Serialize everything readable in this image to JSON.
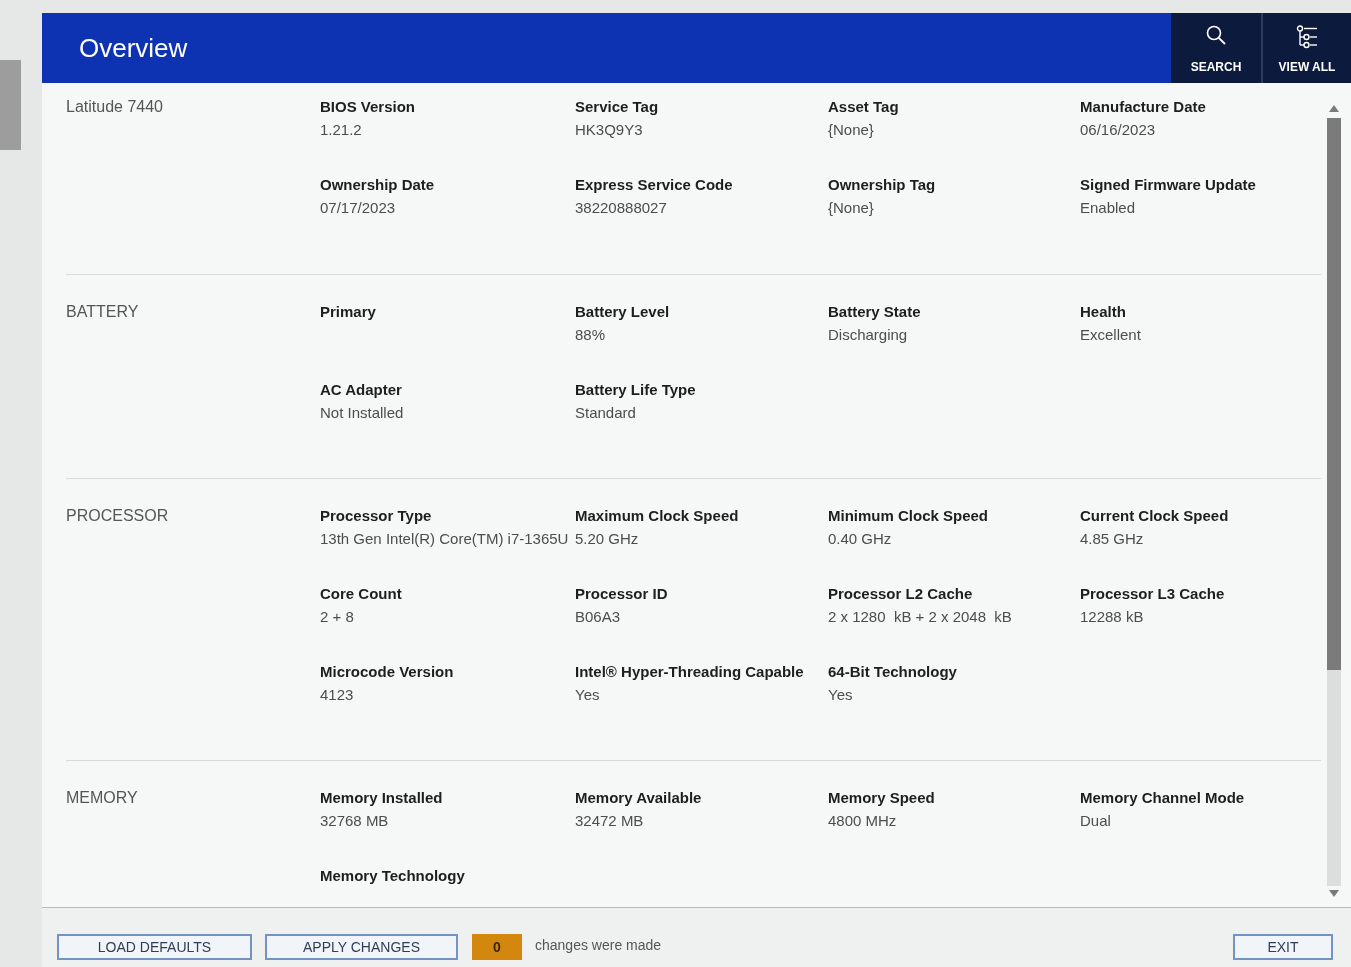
{
  "header": {
    "title": "Overview",
    "actions": [
      {
        "kind": "search",
        "label": "SEARCH"
      },
      {
        "kind": "view-all",
        "label": "VIEW ALL"
      }
    ]
  },
  "sections": [
    {
      "title": "Latitude 7440",
      "rows": [
        [
          {
            "label": "BIOS Version",
            "value": "1.21.2"
          },
          {
            "label": "Service Tag",
            "value": "HK3Q9Y3"
          },
          {
            "label": "Asset Tag",
            "value": "{None}"
          },
          {
            "label": "Manufacture Date",
            "value": "06/16/2023"
          }
        ],
        [
          {
            "label": "Ownership Date",
            "value": "07/17/2023"
          },
          {
            "label": "Express Service Code",
            "value": "38220888027"
          },
          {
            "label": "Ownership Tag",
            "value": "{None}"
          },
          {
            "label": "Signed Firmware Update",
            "value": "Enabled"
          }
        ]
      ]
    },
    {
      "title": "BATTERY",
      "rows": [
        [
          {
            "label": "Primary"
          },
          {
            "label": "Battery Level",
            "value": "88%"
          },
          {
            "label": "Battery State",
            "value": "Discharging"
          },
          {
            "label": "Health",
            "value": "Excellent"
          }
        ],
        [
          {
            "label": "AC Adapter",
            "value": "Not Installed"
          },
          {
            "label": "Battery Life Type",
            "value": "Standard"
          }
        ]
      ]
    },
    {
      "title": "PROCESSOR",
      "rows": [
        [
          {
            "label": "Processor Type",
            "value": "13th Gen Intel(R) Core(TM) i7-1365U"
          },
          {
            "label": "Maximum Clock Speed",
            "value": "5.20 GHz"
          },
          {
            "label": "Minimum Clock Speed",
            "value": "0.40 GHz"
          },
          {
            "label": "Current Clock Speed",
            "value": "4.85 GHz"
          }
        ],
        [
          {
            "label": "Core Count",
            "value": "2 + 8"
          },
          {
            "label": "Processor ID",
            "value": "B06A3"
          },
          {
            "label": "Processor L2 Cache",
            "value": "2 x 1280  kB + 2 x 2048  kB"
          },
          {
            "label": "Processor L3 Cache",
            "value": "12288 kB"
          }
        ],
        [
          {
            "label": "Microcode Version",
            "value": "4123"
          },
          {
            "label": "Intel® Hyper-Threading Capable",
            "value": "Yes"
          },
          {
            "label": "64-Bit Technology",
            "value": "Yes"
          }
        ]
      ]
    },
    {
      "title": "MEMORY",
      "rows": [
        [
          {
            "label": "Memory Installed",
            "value": "32768 MB"
          },
          {
            "label": "Memory Available",
            "value": "32472 MB"
          },
          {
            "label": "Memory Speed",
            "value": "4800 MHz"
          },
          {
            "label": "Memory Channel Mode",
            "value": "Dual"
          }
        ],
        [
          {
            "label": "Memory Technology"
          }
        ]
      ]
    }
  ],
  "footer": {
    "buttons": [
      "LOAD DEFAULTS",
      "APPLY CHANGES"
    ],
    "change_count": "0",
    "change_text": "changes were made",
    "exit": "EXIT"
  }
}
